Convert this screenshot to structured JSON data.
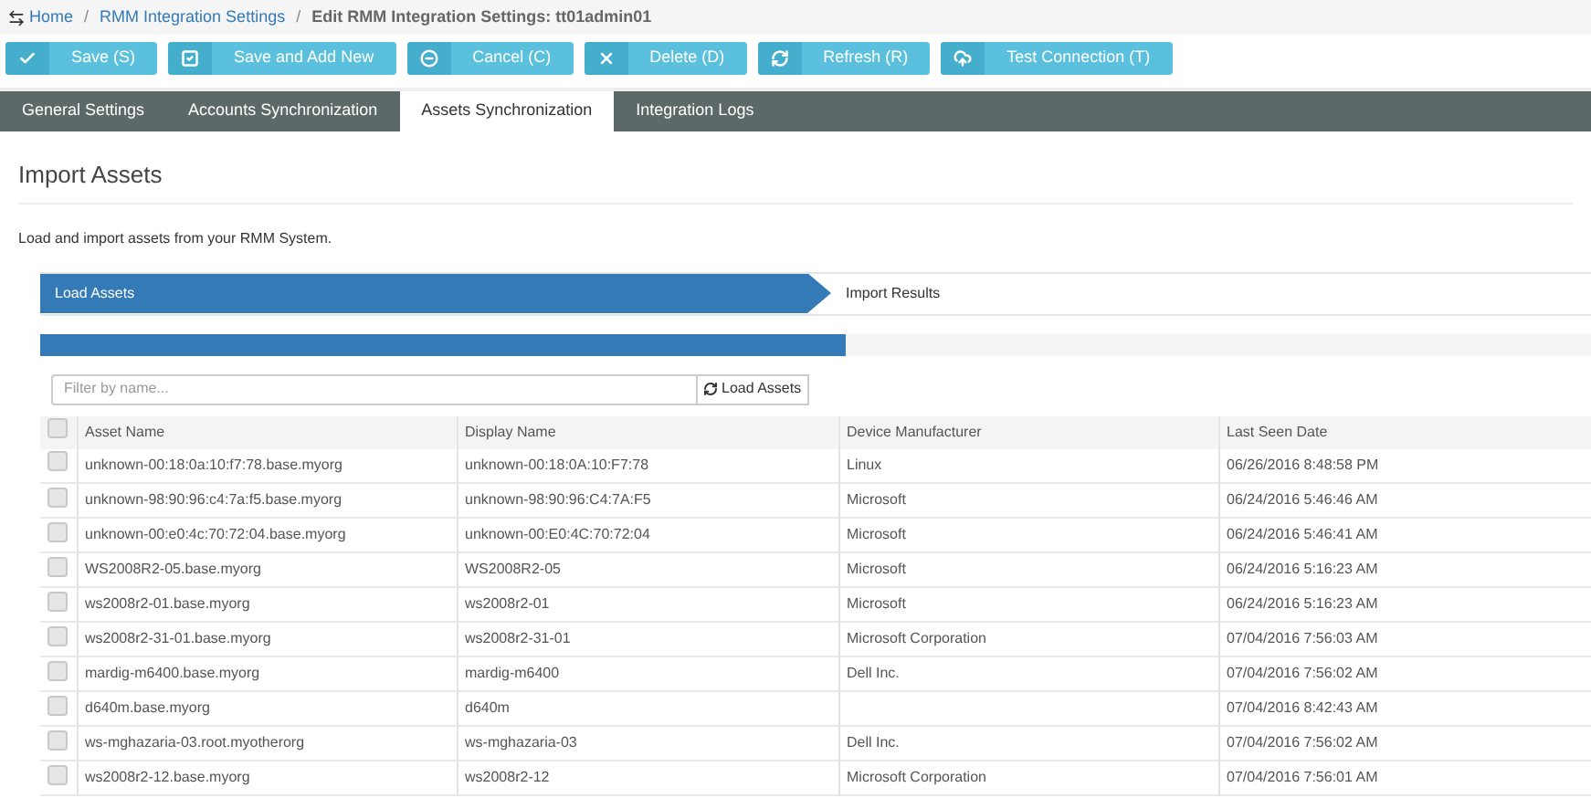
{
  "breadcrumb_separator": "/",
  "breadcrumb": [
    {
      "label": "Home",
      "link": true
    },
    {
      "label": "RMM Integration Settings",
      "link": true
    },
    {
      "label": "Edit RMM Integration Settings: tt01admin01",
      "link": false
    }
  ],
  "toolbar": [
    {
      "label": "Save (S)",
      "kind": "check"
    },
    {
      "label": "Save and Add New",
      "kind": "check-square"
    },
    {
      "label": "Cancel (C)",
      "kind": "minus"
    },
    {
      "label": "Delete (D)",
      "kind": "x"
    },
    {
      "label": "Refresh (R)",
      "kind": "refresh"
    },
    {
      "label": "Test Connection (T)",
      "kind": "upload"
    }
  ],
  "tabs": [
    {
      "label": "General Settings",
      "selected": false
    },
    {
      "label": "Accounts Synchronization",
      "selected": false
    },
    {
      "label": "Assets Synchronization",
      "selected": true
    },
    {
      "label": "Integration Logs",
      "selected": false
    }
  ],
  "heading": "Import Assets",
  "description": "Load and import assets from your RMM System.",
  "wizard_steps": [
    {
      "label": "Load Assets",
      "selected": true
    },
    {
      "label": "Import Results",
      "selected": false
    }
  ],
  "progress": {
    "level": 0.52
  },
  "filter": {
    "placeholder": "Filter by name...",
    "button": "Load Assets"
  },
  "table": {
    "all_checked": false,
    "columns": [
      "Asset Name",
      "Display Name",
      "Device Manufacturer",
      "Last Seen Date"
    ],
    "rows": [
      {
        "checked": false,
        "asset_name": "unknown-00:18:0a:10:f7:78.base.myorg",
        "display_name": "unknown-00:18:0A:10:F7:78",
        "manufacturer": "Linux",
        "last_seen": "06/26/2016 8:48:58 PM"
      },
      {
        "checked": false,
        "asset_name": "unknown-98:90:96:c4:7a:f5.base.myorg",
        "display_name": "unknown-98:90:96:C4:7A:F5",
        "manufacturer": "Microsoft",
        "last_seen": "06/24/2016 5:46:46 AM"
      },
      {
        "checked": false,
        "asset_name": "unknown-00:e0:4c:70:72:04.base.myorg",
        "display_name": "unknown-00:E0:4C:70:72:04",
        "manufacturer": "Microsoft",
        "last_seen": "06/24/2016 5:46:41 AM"
      },
      {
        "checked": false,
        "asset_name": "WS2008R2-05.base.myorg",
        "display_name": "WS2008R2-05",
        "manufacturer": "Microsoft",
        "last_seen": "06/24/2016 5:16:23 AM"
      },
      {
        "checked": false,
        "asset_name": "ws2008r2-01.base.myorg",
        "display_name": "ws2008r2-01",
        "manufacturer": "Microsoft",
        "last_seen": "06/24/2016 5:16:23 AM"
      },
      {
        "checked": false,
        "asset_name": "ws2008r2-31-01.base.myorg",
        "display_name": "ws2008r2-31-01",
        "manufacturer": "Microsoft Corporation",
        "last_seen": "07/04/2016 7:56:03 AM"
      },
      {
        "checked": false,
        "asset_name": "mardig-m6400.base.myorg",
        "display_name": "mardig-m6400",
        "manufacturer": "Dell Inc.",
        "last_seen": "07/04/2016 7:56:02 AM"
      },
      {
        "checked": false,
        "asset_name": "d640m.base.myorg",
        "display_name": "d640m",
        "last_seen": "07/04/2016 8:42:43 AM"
      },
      {
        "checked": false,
        "asset_name": "ws-mghazaria-03.root.myotherorg",
        "display_name": "ws-mghazaria-03",
        "manufacturer": "Dell Inc.",
        "last_seen": "07/04/2016 7:56:02 AM"
      },
      {
        "checked": false,
        "asset_name": "ws2008r2-12.base.myorg",
        "display_name": "ws2008r2-12",
        "manufacturer": "Microsoft Corporation",
        "last_seen": "07/04/2016 7:56:01 AM"
      }
    ]
  }
}
